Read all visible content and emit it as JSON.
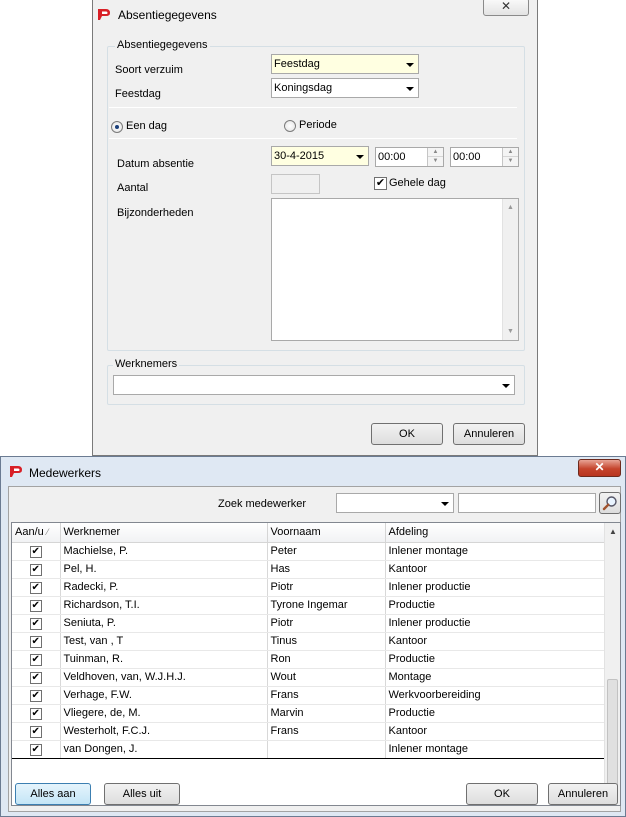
{
  "absence_dialog": {
    "title": "Absentiegegevens",
    "close_label": "✕",
    "group_title": "Absentiegegevens",
    "soort_verzuim_label": "Soort verzuim",
    "soort_verzuim_value": "Feestdag",
    "feestdag_label": "Feestdag",
    "feestdag_value": "Koningsdag",
    "radio_een_dag": "Een dag",
    "radio_periode": "Periode",
    "radio_selected": "Een dag",
    "datum_label": "Datum absentie",
    "datum_value": "30-4-2015",
    "time_from": "00:00",
    "time_to": "00:00",
    "aantal_label": "Aantal",
    "aantal_value": "",
    "gehele_dag_label": "Gehele dag",
    "gehele_dag_checked": true,
    "bijzonderheden_label": "Bijzonderheden",
    "bijzonderheden_value": "",
    "werknemers_label": "Werknemers",
    "werknemers_value": "",
    "ok_label": "OK",
    "annuleren_label": "Annuleren"
  },
  "employees_dialog": {
    "title": "Medewerkers",
    "close_label": "✕",
    "search_label": "Zoek medewerker",
    "search_combo_value": "",
    "search_text_value": "",
    "columns": [
      "Aan/u",
      "Werknemer",
      "Voornaam",
      "Afdeling"
    ],
    "rows": [
      {
        "checked": true,
        "werknemer": "Machielse, P.",
        "voornaam": "Peter",
        "afdeling": "Inlener montage"
      },
      {
        "checked": true,
        "werknemer": "Pel, H.",
        "voornaam": "Has",
        "afdeling": "Kantoor"
      },
      {
        "checked": true,
        "werknemer": "Radecki, P.",
        "voornaam": "Piotr",
        "afdeling": "Inlener productie"
      },
      {
        "checked": true,
        "werknemer": "Richardson, T.I.",
        "voornaam": "Tyrone Ingemar",
        "afdeling": "Productie"
      },
      {
        "checked": true,
        "werknemer": "Seniuta, P.",
        "voornaam": "Piotr",
        "afdeling": "Inlener productie"
      },
      {
        "checked": true,
        "werknemer": "Test, van , T",
        "voornaam": "Tinus",
        "afdeling": "Kantoor"
      },
      {
        "checked": true,
        "werknemer": "Tuinman, R.",
        "voornaam": "Ron",
        "afdeling": "Productie"
      },
      {
        "checked": true,
        "werknemer": "Veldhoven, van, W.J.H.J.",
        "voornaam": "Wout",
        "afdeling": "Montage"
      },
      {
        "checked": true,
        "werknemer": "Verhage, F.W.",
        "voornaam": "Frans",
        "afdeling": "Werkvoorbereiding"
      },
      {
        "checked": true,
        "werknemer": "Vliegere, de, M.",
        "voornaam": "Marvin",
        "afdeling": "Productie"
      },
      {
        "checked": true,
        "werknemer": "Westerholt, F.C.J.",
        "voornaam": "Frans",
        "afdeling": "Kantoor"
      },
      {
        "checked": true,
        "werknemer": "van Dongen, J.",
        "voornaam": "",
        "afdeling": "Inlener montage"
      }
    ],
    "selected_row_index": 11,
    "alles_aan_label": "Alles aan",
    "alles_uit_label": "Alles uit",
    "ok_label": "OK",
    "annuleren_label": "Annuleren"
  },
  "colors": {
    "dialog_bg": "#f0f0f0",
    "highlight_yellow": "#ffffe1",
    "brand_red": "#d81f26",
    "close_red": "#c5442c",
    "primary_button_blue": "#c4e5f6"
  },
  "icons": {
    "app_logo": "red-logo-icon",
    "search": "magnifier-icon",
    "dropdown": "chevron-down-icon"
  }
}
